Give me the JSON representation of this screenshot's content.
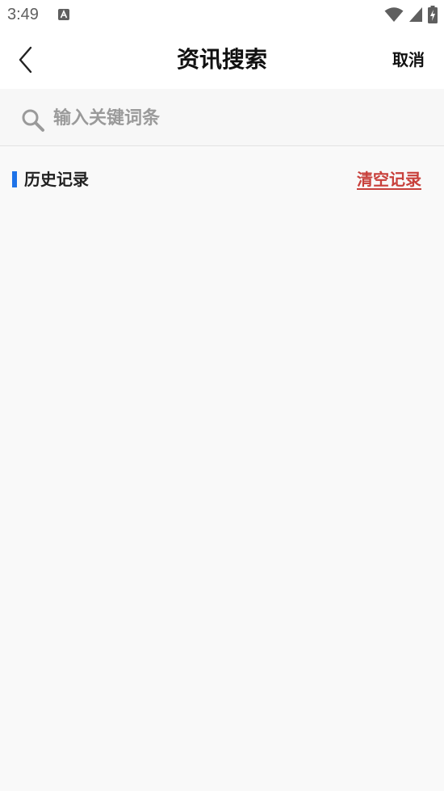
{
  "status_bar": {
    "time": "3:49",
    "notification_icon": "font-a-icon",
    "icons": [
      "wifi-icon",
      "cell-signal-icon",
      "battery-charging-icon"
    ]
  },
  "nav": {
    "back_icon": "chevron-left-icon",
    "title": "资讯搜索",
    "cancel_label": "取消"
  },
  "search": {
    "icon": "search-icon",
    "value": "",
    "placeholder": "输入关键词条"
  },
  "history": {
    "title": "历史记录",
    "clear_label": "清空记录",
    "items": []
  },
  "colors": {
    "accent": "#1e73e8",
    "clear": "#c8403b",
    "background": "#f9f9f9",
    "header_bg": "#ffffff"
  }
}
